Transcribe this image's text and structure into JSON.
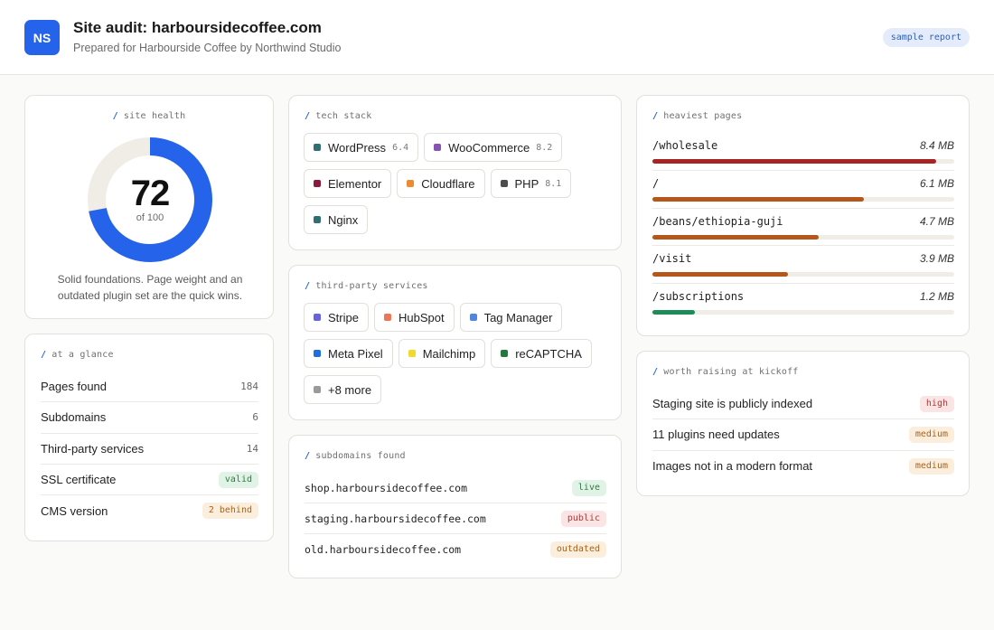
{
  "header": {
    "logo_text": "NS",
    "title": "Site audit: harboursidecoffee.com",
    "subtitle": "Prepared for Harbourside Coffee by Northwind Studio",
    "badge": "sample report"
  },
  "health": {
    "label": "site health",
    "score": "72",
    "score_value": 72,
    "of_text": "of 100",
    "score_max": 100,
    "gauge_color": "#2563eb",
    "description": "Solid foundations. Page weight and an outdated plugin set are the quick wins."
  },
  "glance": {
    "label": "at a glance",
    "rows": [
      {
        "label": "Pages found",
        "value": "184",
        "style": "plain"
      },
      {
        "label": "Subdomains",
        "value": "6",
        "style": "plain"
      },
      {
        "label": "Third-party services",
        "value": "14",
        "style": "plain"
      },
      {
        "label": "SSL certificate",
        "value": "valid",
        "style": "green"
      },
      {
        "label": "CMS version",
        "value": "2 behind",
        "style": "orange"
      }
    ]
  },
  "tech": {
    "label": "tech stack",
    "chips": [
      {
        "name": "WordPress",
        "version": "6.4",
        "color": "#2f6f73"
      },
      {
        "name": "WooCommerce",
        "version": "8.2",
        "color": "#8653b3"
      },
      {
        "name": "Elementor",
        "version": "",
        "color": "#8b1a3f"
      },
      {
        "name": "Cloudflare",
        "version": "",
        "color": "#ee8a2f"
      },
      {
        "name": "PHP",
        "version": "8.1",
        "color": "#4d4d4d"
      },
      {
        "name": "Nginx",
        "version": "",
        "color": "#2f6f73"
      }
    ]
  },
  "third_party": {
    "label": "third-party services",
    "chips": [
      {
        "name": "Stripe",
        "version": "",
        "color": "#6762e3"
      },
      {
        "name": "HubSpot",
        "version": "",
        "color": "#f07455"
      },
      {
        "name": "Tag Manager",
        "version": "",
        "color": "#4e86e2"
      },
      {
        "name": "Meta Pixel",
        "version": "",
        "color": "#1f6de0"
      },
      {
        "name": "Mailchimp",
        "version": "",
        "color": "#f3d92c"
      },
      {
        "name": "reCAPTCHA",
        "version": "",
        "color": "#1f7a3c"
      },
      {
        "name": "+8 more",
        "version": "",
        "color": "#9a9a9a"
      }
    ]
  },
  "subdomains": {
    "label": "subdomains found",
    "rows": [
      {
        "host": "shop.harboursidecoffee.com",
        "status": "live",
        "style": "green"
      },
      {
        "host": "staging.harboursidecoffee.com",
        "status": "public",
        "style": "red"
      },
      {
        "host": "old.harboursidecoffee.com",
        "status": "outdated",
        "style": "orange"
      }
    ]
  },
  "heaviest": {
    "label": "heaviest pages",
    "max_mb": 8.4,
    "rows": [
      {
        "path": "/wholesale",
        "size": "8.4 MB",
        "mb": 8.4,
        "fraction": 0.94,
        "color": "#a82323"
      },
      {
        "path": "/",
        "size": "6.1 MB",
        "mb": 6.1,
        "fraction": 0.7,
        "color": "#b5561a"
      },
      {
        "path": "/beans/ethiopia-guji",
        "size": "4.7 MB",
        "mb": 4.7,
        "fraction": 0.55,
        "color": "#b5561a"
      },
      {
        "path": "/visit",
        "size": "3.9 MB",
        "mb": 3.9,
        "fraction": 0.45,
        "color": "#b5561a"
      },
      {
        "path": "/subscriptions",
        "size": "1.2 MB",
        "mb": 1.2,
        "fraction": 0.14,
        "color": "#1f8a5a"
      }
    ]
  },
  "raise": {
    "label": "worth raising at kickoff",
    "rows": [
      {
        "text": "Staging site is publicly indexed",
        "level": "high",
        "style": "red"
      },
      {
        "text": "11 plugins need updates",
        "level": "medium",
        "style": "orange"
      },
      {
        "text": "Images not in a modern format",
        "level": "medium",
        "style": "orange"
      }
    ]
  }
}
